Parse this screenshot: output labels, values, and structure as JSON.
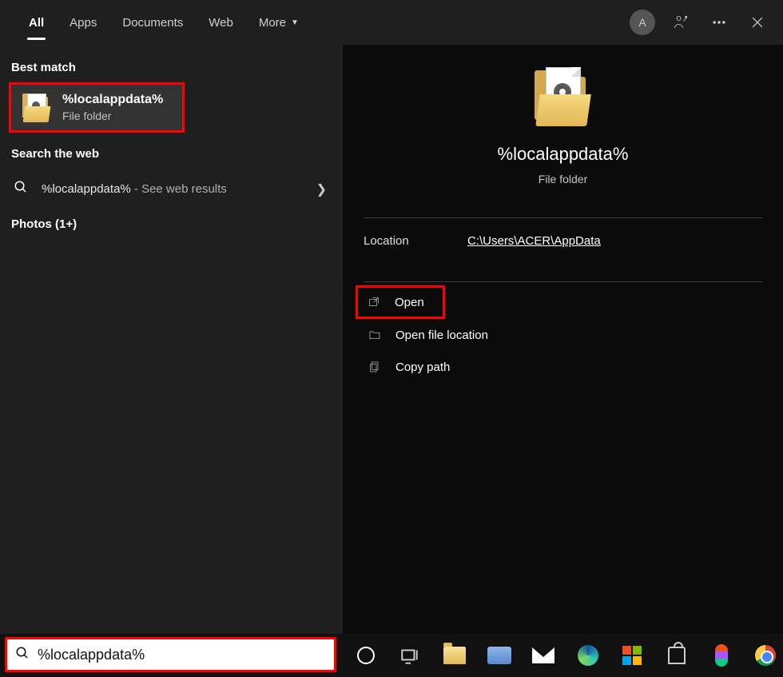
{
  "tabs": {
    "all": "All",
    "apps": "Apps",
    "documents": "Documents",
    "web": "Web",
    "more": "More"
  },
  "avatar_initial": "A",
  "left": {
    "best_match_heading": "Best match",
    "result_title": "%localappdata%",
    "result_subtitle": "File folder",
    "search_web_heading": "Search the web",
    "web_query": "%localappdata%",
    "web_suffix": " - See web results",
    "photos_heading": "Photos (1+)"
  },
  "detail": {
    "title": "%localappdata%",
    "subtitle": "File folder",
    "location_key": "Location",
    "location_val": "C:\\Users\\ACER\\AppData",
    "actions": {
      "open": "Open",
      "open_loc": "Open file location",
      "copy_path": "Copy path"
    }
  },
  "search_value": "%localappdata%"
}
